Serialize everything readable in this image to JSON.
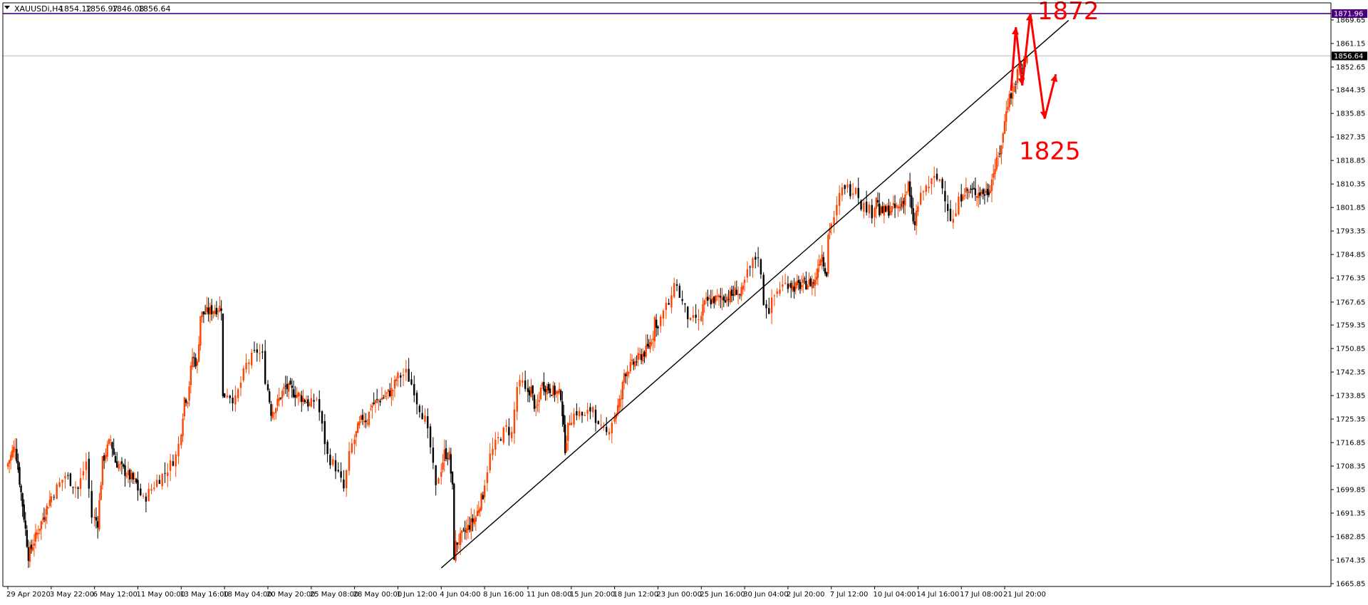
{
  "window": {
    "menu_icon": "triangle-down-icon",
    "symbol": "XAUUSDi,H4",
    "ohlc": [
      "1854.12",
      "1856.97",
      "1846.08",
      "1856.64"
    ]
  },
  "chart_data": {
    "type": "candlestick",
    "symbol": "XAUUSDi",
    "timeframe": "H4",
    "colors": {
      "bull": "#ff4500",
      "bear": "#000000",
      "axis": "#000000",
      "trendline": "#000000",
      "annotation": "#ff0000",
      "price_line": "#c0c0c0",
      "horizontal_line": "#4b0082",
      "horizontal_badge": "#4b0082",
      "current_badge": "#000000"
    },
    "price_axis": {
      "min": 1665.85,
      "max": 1875.5,
      "ticks": [
        "1869.65",
        "1861.15",
        "1852.65",
        "1844.35",
        "1835.85",
        "1827.35",
        "1818.85",
        "1810.35",
        "1801.85",
        "1793.35",
        "1784.85",
        "1776.35",
        "1767.65",
        "1759.35",
        "1750.85",
        "1742.35",
        "1733.85",
        "1725.35",
        "1716.85",
        "1708.35",
        "1699.85",
        "1691.35",
        "1682.85",
        "1674.35",
        "1665.85"
      ]
    },
    "time_axis": {
      "first_time": "2020-04-29 00:00",
      "last_time": "2020-07-24 04:00",
      "right_end_time": "2020-07-30 00:00",
      "labels": [
        {
          "text": "29 Apr 2020",
          "time": "2020-04-29 00:00"
        },
        {
          "text": "3 May 22:00",
          "time": "2020-05-03 22:00"
        },
        {
          "text": "6 May 12:00",
          "time": "2020-05-06 12:00"
        },
        {
          "text": "11 May 00:00",
          "time": "2020-05-11 00:00"
        },
        {
          "text": "13 May 16:00",
          "time": "2020-05-13 16:00"
        },
        {
          "text": "18 May 04:00",
          "time": "2020-05-18 04:00"
        },
        {
          "text": "20 May 20:00",
          "time": "2020-05-20 20:00"
        },
        {
          "text": "25 May 08:00",
          "time": "2020-05-25 08:00"
        },
        {
          "text": "28 May 00:00",
          "time": "2020-05-28 00:00"
        },
        {
          "text": "1 Jun 12:00",
          "time": "2020-06-01 12:00"
        },
        {
          "text": "4 Jun 04:00",
          "time": "2020-06-04 04:00"
        },
        {
          "text": "8 Jun 16:00",
          "time": "2020-06-08 16:00"
        },
        {
          "text": "11 Jun 08:00",
          "time": "2020-06-11 08:00"
        },
        {
          "text": "15 Jun 20:00",
          "time": "2020-06-15 20:00"
        },
        {
          "text": "18 Jun 12:00",
          "time": "2020-06-18 12:00"
        },
        {
          "text": "23 Jun 00:00",
          "time": "2020-06-23 00:00"
        },
        {
          "text": "25 Jun 16:00",
          "time": "2020-06-25 16:00"
        },
        {
          "text": "30 Jun 04:00",
          "time": "2020-06-30 04:00"
        },
        {
          "text": "2 Jul 20:00",
          "time": "2020-07-02 20:00"
        },
        {
          "text": "7 Jul 12:00",
          "time": "2020-07-07 12:00"
        },
        {
          "text": "10 Jul 04:00",
          "time": "2020-07-10 04:00"
        },
        {
          "text": "14 Jul 16:00",
          "time": "2020-07-14 16:00"
        },
        {
          "text": "17 Jul 08:00",
          "time": "2020-07-17 08:00"
        },
        {
          "text": "21 Jul 20:00",
          "time": "2020-07-21 20:00"
        }
      ]
    },
    "close_path": [
      {
        "time": "2020-04-29 00:00",
        "close": 1708
      },
      {
        "time": "2020-04-30 00:00",
        "close": 1716
      },
      {
        "time": "2020-05-01 00:00",
        "close": 1690
      },
      {
        "time": "2020-05-01 12:00",
        "close": 1676
      },
      {
        "time": "2020-05-03 22:00",
        "close": 1696
      },
      {
        "time": "2020-05-04 22:00",
        "close": 1705
      },
      {
        "time": "2020-05-05 16:00",
        "close": 1700
      },
      {
        "time": "2020-05-06 04:00",
        "close": 1710
      },
      {
        "time": "2020-05-06 12:00",
        "close": 1690
      },
      {
        "time": "2020-05-07 00:00",
        "close": 1688
      },
      {
        "time": "2020-05-07 12:00",
        "close": 1710
      },
      {
        "time": "2020-05-08 08:00",
        "close": 1718
      },
      {
        "time": "2020-05-08 20:00",
        "close": 1710
      },
      {
        "time": "2020-05-11 00:00",
        "close": 1702
      },
      {
        "time": "2020-05-11 12:00",
        "close": 1696
      },
      {
        "time": "2020-05-12 08:00",
        "close": 1703
      },
      {
        "time": "2020-05-12 20:00",
        "close": 1706
      },
      {
        "time": "2020-05-13 12:00",
        "close": 1712
      },
      {
        "time": "2020-05-13 16:00",
        "close": 1716
      },
      {
        "time": "2020-05-14 04:00",
        "close": 1733
      },
      {
        "time": "2020-05-14 12:00",
        "close": 1733
      },
      {
        "time": "2020-05-15 00:00",
        "close": 1748
      },
      {
        "time": "2020-05-15 12:00",
        "close": 1745
      },
      {
        "time": "2020-05-15 20:00",
        "close": 1763
      },
      {
        "time": "2020-05-18 00:00",
        "close": 1766
      },
      {
        "time": "2020-05-18 04:00",
        "close": 1733
      },
      {
        "time": "2020-05-18 12:00",
        "close": 1735
      },
      {
        "time": "2020-05-19 00:00",
        "close": 1732
      },
      {
        "time": "2020-05-19 16:00",
        "close": 1745
      },
      {
        "time": "2020-05-20 08:00",
        "close": 1750
      },
      {
        "time": "2020-05-20 16:00",
        "close": 1748
      },
      {
        "time": "2020-05-20 20:00",
        "close": 1740
      },
      {
        "time": "2020-05-21 08:00",
        "close": 1728
      },
      {
        "time": "2020-05-21 20:00",
        "close": 1730
      },
      {
        "time": "2020-05-22 12:00",
        "close": 1735
      },
      {
        "time": "2020-05-22 20:00",
        "close": 1737
      },
      {
        "time": "2020-05-25 00:00",
        "close": 1732
      },
      {
        "time": "2020-05-25 08:00",
        "close": 1730
      },
      {
        "time": "2020-05-25 20:00",
        "close": 1733
      },
      {
        "time": "2020-05-26 12:00",
        "close": 1712
      },
      {
        "time": "2020-05-27 00:00",
        "close": 1708
      },
      {
        "time": "2020-05-27 12:00",
        "close": 1700
      },
      {
        "time": "2020-05-27 20:00",
        "close": 1712
      },
      {
        "time": "2020-05-28 00:00",
        "close": 1716
      },
      {
        "time": "2020-05-28 12:00",
        "close": 1722
      },
      {
        "time": "2020-05-29 00:00",
        "close": 1726
      },
      {
        "time": "2020-05-29 12:00",
        "close": 1725
      },
      {
        "time": "2020-05-29 20:00",
        "close": 1730
      },
      {
        "time": "2020-06-01 04:00",
        "close": 1736
      },
      {
        "time": "2020-06-01 12:00",
        "close": 1740
      },
      {
        "time": "2020-06-02 04:00",
        "close": 1742
      },
      {
        "time": "2020-06-02 16:00",
        "close": 1736
      },
      {
        "time": "2020-06-02 20:00",
        "close": 1732
      },
      {
        "time": "2020-06-03 08:00",
        "close": 1725
      },
      {
        "time": "2020-06-03 16:00",
        "close": 1715
      },
      {
        "time": "2020-06-04 00:00",
        "close": 1700
      },
      {
        "time": "2020-06-04 04:00",
        "close": 1705
      },
      {
        "time": "2020-06-04 16:00",
        "close": 1713
      },
      {
        "time": "2020-06-05 04:00",
        "close": 1712
      },
      {
        "time": "2020-06-05 12:00",
        "close": 1700
      },
      {
        "time": "2020-06-05 16:00",
        "close": 1676
      },
      {
        "time": "2020-06-05 20:00",
        "close": 1680
      },
      {
        "time": "2020-06-07 22:00",
        "close": 1690
      },
      {
        "time": "2020-06-08 08:00",
        "close": 1695
      },
      {
        "time": "2020-06-08 16:00",
        "close": 1698
      },
      {
        "time": "2020-06-09 04:00",
        "close": 1712
      },
      {
        "time": "2020-06-09 16:00",
        "close": 1718
      },
      {
        "time": "2020-06-10 04:00",
        "close": 1722
      },
      {
        "time": "2020-06-10 12:00",
        "close": 1720
      },
      {
        "time": "2020-06-10 20:00",
        "close": 1737
      },
      {
        "time": "2020-06-11 04:00",
        "close": 1738
      },
      {
        "time": "2020-06-11 08:00",
        "close": 1735
      },
      {
        "time": "2020-06-11 20:00",
        "close": 1736
      },
      {
        "time": "2020-06-12 08:00",
        "close": 1728
      },
      {
        "time": "2020-06-12 16:00",
        "close": 1732
      },
      {
        "time": "2020-06-12 20:00",
        "close": 1738
      },
      {
        "time": "2020-06-14 22:00",
        "close": 1734
      },
      {
        "time": "2020-06-15 08:00",
        "close": 1715
      },
      {
        "time": "2020-06-15 16:00",
        "close": 1722
      },
      {
        "time": "2020-06-15 20:00",
        "close": 1725
      },
      {
        "time": "2020-06-16 08:00",
        "close": 1728
      },
      {
        "time": "2020-06-16 20:00",
        "close": 1726
      },
      {
        "time": "2020-06-17 08:00",
        "close": 1730
      },
      {
        "time": "2020-06-17 16:00",
        "close": 1722
      },
      {
        "time": "2020-06-18 04:00",
        "close": 1720
      },
      {
        "time": "2020-06-18 12:00",
        "close": 1725
      },
      {
        "time": "2020-06-18 20:00",
        "close": 1728
      },
      {
        "time": "2020-06-19 08:00",
        "close": 1733
      },
      {
        "time": "2020-06-19 16:00",
        "close": 1742
      },
      {
        "time": "2020-06-21 22:00",
        "close": 1750
      },
      {
        "time": "2020-06-22 08:00",
        "close": 1753
      },
      {
        "time": "2020-06-22 16:00",
        "close": 1756
      },
      {
        "time": "2020-06-22 20:00",
        "close": 1762
      },
      {
        "time": "2020-06-23 00:00",
        "close": 1758
      },
      {
        "time": "2020-06-23 08:00",
        "close": 1762
      },
      {
        "time": "2020-06-23 16:00",
        "close": 1766
      },
      {
        "time": "2020-06-24 00:00",
        "close": 1768
      },
      {
        "time": "2020-06-24 04:00",
        "close": 1776
      },
      {
        "time": "2020-06-24 12:00",
        "close": 1770
      },
      {
        "time": "2020-06-24 20:00",
        "close": 1765
      },
      {
        "time": "2020-06-25 04:00",
        "close": 1760
      },
      {
        "time": "2020-06-25 12:00",
        "close": 1762
      },
      {
        "time": "2020-06-25 16:00",
        "close": 1760
      },
      {
        "time": "2020-06-26 00:00",
        "close": 1766
      },
      {
        "time": "2020-06-26 12:00",
        "close": 1768
      },
      {
        "time": "2020-06-29 00:00",
        "close": 1770
      },
      {
        "time": "2020-06-29 12:00",
        "close": 1772
      },
      {
        "time": "2020-06-29 20:00",
        "close": 1770
      },
      {
        "time": "2020-06-30 04:00",
        "close": 1772
      },
      {
        "time": "2020-06-30 12:00",
        "close": 1778
      },
      {
        "time": "2020-06-30 20:00",
        "close": 1782
      },
      {
        "time": "2020-07-01 04:00",
        "close": 1785
      },
      {
        "time": "2020-07-01 12:00",
        "close": 1768
      },
      {
        "time": "2020-07-01 20:00",
        "close": 1765
      },
      {
        "time": "2020-07-02 04:00",
        "close": 1770
      },
      {
        "time": "2020-07-02 12:00",
        "close": 1773
      },
      {
        "time": "2020-07-02 20:00",
        "close": 1774
      },
      {
        "time": "2020-07-03 04:00",
        "close": 1775
      },
      {
        "time": "2020-07-03 12:00",
        "close": 1773
      },
      {
        "time": "2020-07-05 22:00",
        "close": 1775
      },
      {
        "time": "2020-07-06 08:00",
        "close": 1783
      },
      {
        "time": "2020-07-06 16:00",
        "close": 1785
      },
      {
        "time": "2020-07-06 20:00",
        "close": 1782
      },
      {
        "time": "2020-07-07 04:00",
        "close": 1778
      },
      {
        "time": "2020-07-07 08:00",
        "close": 1792
      },
      {
        "time": "2020-07-07 12:00",
        "close": 1795
      },
      {
        "time": "2020-07-07 20:00",
        "close": 1797
      },
      {
        "time": "2020-07-08 04:00",
        "close": 1806
      },
      {
        "time": "2020-07-08 12:00",
        "close": 1810
      },
      {
        "time": "2020-07-08 20:00",
        "close": 1808
      },
      {
        "time": "2020-07-09 04:00",
        "close": 1810
      },
      {
        "time": "2020-07-09 12:00",
        "close": 1803
      },
      {
        "time": "2020-07-09 20:00",
        "close": 1802
      },
      {
        "time": "2020-07-10 04:00",
        "close": 1800
      },
      {
        "time": "2020-07-10 12:00",
        "close": 1806
      },
      {
        "time": "2020-07-10 20:00",
        "close": 1800
      },
      {
        "time": "2020-07-12 22:00",
        "close": 1802
      },
      {
        "time": "2020-07-13 08:00",
        "close": 1805
      },
      {
        "time": "2020-07-13 16:00",
        "close": 1808
      },
      {
        "time": "2020-07-13 20:00",
        "close": 1810
      },
      {
        "time": "2020-07-14 04:00",
        "close": 1800
      },
      {
        "time": "2020-07-14 12:00",
        "close": 1795
      },
      {
        "time": "2020-07-14 16:00",
        "close": 1800
      },
      {
        "time": "2020-07-15 04:00",
        "close": 1808
      },
      {
        "time": "2020-07-15 12:00",
        "close": 1810
      },
      {
        "time": "2020-07-15 20:00",
        "close": 1812
      },
      {
        "time": "2020-07-16 04:00",
        "close": 1812
      },
      {
        "time": "2020-07-16 12:00",
        "close": 1806
      },
      {
        "time": "2020-07-16 20:00",
        "close": 1798
      },
      {
        "time": "2020-07-17 00:00",
        "close": 1797
      },
      {
        "time": "2020-07-17 04:00",
        "close": 1800
      },
      {
        "time": "2020-07-17 08:00",
        "close": 1804
      },
      {
        "time": "2020-07-17 16:00",
        "close": 1808
      },
      {
        "time": "2020-07-19 22:00",
        "close": 1807
      },
      {
        "time": "2020-07-20 08:00",
        "close": 1808
      },
      {
        "time": "2020-07-20 16:00",
        "close": 1812
      },
      {
        "time": "2020-07-20 20:00",
        "close": 1815
      },
      {
        "time": "2020-07-21 04:00",
        "close": 1818
      },
      {
        "time": "2020-07-21 12:00",
        "close": 1822
      },
      {
        "time": "2020-07-21 20:00",
        "close": 1828
      },
      {
        "time": "2020-07-22 04:00",
        "close": 1838
      },
      {
        "time": "2020-07-22 12:00",
        "close": 1842
      },
      {
        "time": "2020-07-22 20:00",
        "close": 1843
      },
      {
        "time": "2020-07-23 04:00",
        "close": 1848
      },
      {
        "time": "2020-07-23 12:00",
        "close": 1853
      },
      {
        "time": "2020-07-23 20:00",
        "close": 1852
      },
      {
        "time": "2020-07-24 04:00",
        "close": 1856.64
      }
    ],
    "current_price": 1856.64,
    "current_price_label": "1856.64",
    "horizontal_line": {
      "price": 1871.96,
      "label": "1871.96"
    },
    "trendline": {
      "start": {
        "time": "2020-06-04 04:00",
        "price": 1671.5
      },
      "end": {
        "time": "2020-07-28 12:00",
        "price": 1869.5
      }
    },
    "projection": {
      "points": [
        {
          "time": "2020-07-22 12:00",
          "price": 1844
        },
        {
          "time": "2020-07-23 00:00",
          "price": 1867
        },
        {
          "time": "2020-07-23 16:00",
          "price": 1846
        },
        {
          "time": "2020-07-24 12:00",
          "price": 1872
        },
        {
          "time": "2020-07-26 00:00",
          "price": 1834
        },
        {
          "time": "2020-07-27 04:00",
          "price": 1850
        }
      ]
    },
    "annotations": [
      {
        "text": "1872",
        "time": "2020-07-24 12:00",
        "price": 1872
      },
      {
        "text": "1825",
        "time": "2020-07-26 00:00",
        "price": 1825
      }
    ]
  }
}
